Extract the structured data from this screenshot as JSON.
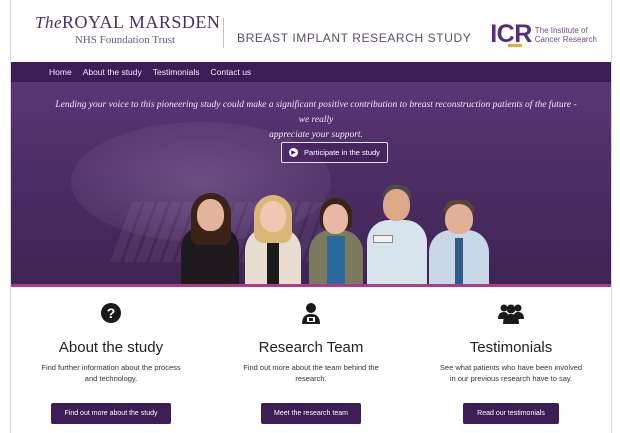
{
  "header": {
    "org_prefix": "The",
    "org_name": "ROYAL MARSDEN",
    "org_sub": "NHS Foundation Trust",
    "study_title": "BREAST IMPLANT RESEARCH STUDY",
    "icr_mark": "ICR",
    "icr_line1": "The Institute of",
    "icr_line2": "Cancer Research"
  },
  "nav": {
    "items": [
      "Home",
      "About the study",
      "Testimonials",
      "Contact us"
    ]
  },
  "hero": {
    "quote_line1": "Lending your voice to this pioneering study could make a significant positive contribution to breast reconstruction patients of the future - we really",
    "quote_line2": "appreciate your support.",
    "cta_label": "Participate in the study"
  },
  "columns": [
    {
      "icon": "question-icon",
      "title": "About the study",
      "desc_line1": "Find further information about the process",
      "desc_line2": "and technology.",
      "button": "Find out more about the study"
    },
    {
      "icon": "researcher-icon",
      "title": "Research Team",
      "desc_line1": "Find out more about the team behind the",
      "desc_line2": "research.",
      "button": "Meet the research team"
    },
    {
      "icon": "group-icon",
      "title": "Testimonials",
      "desc_line1": "See what patients who have been involved",
      "desc_line2": "in our previous research have to say.",
      "button": "Read our testimonials"
    }
  ],
  "colors": {
    "brand_purple": "#3c1d56",
    "accent_magenta": "#b0398f",
    "icr_yellow": "#e5b12c"
  }
}
